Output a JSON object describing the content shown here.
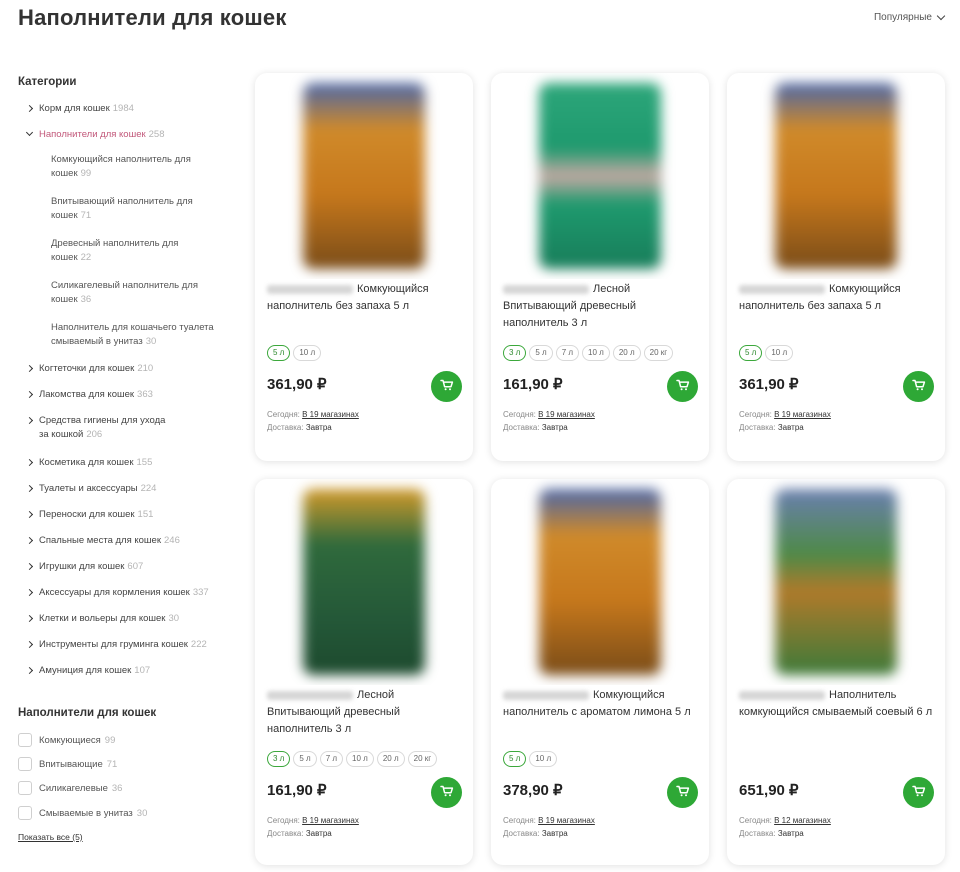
{
  "page": {
    "title": "Наполнители для кошек",
    "sort_label": "Популярные"
  },
  "sidebar": {
    "heading": "Категории",
    "categories": [
      {
        "label": "Корм для кошек",
        "count": "1984"
      },
      {
        "label": "Наполнители для кошек",
        "count": "258"
      },
      {
        "label": "Когтеточки для кошек",
        "count": "210"
      },
      {
        "label": "Лакомства для кошек",
        "count": "363"
      },
      {
        "label": "Средства гигиены для ухода",
        "label2": "за кошкой",
        "count": "206"
      },
      {
        "label": "Косметика для кошек",
        "count": "155"
      },
      {
        "label": "Туалеты и аксессуары",
        "count": "224"
      },
      {
        "label": "Переноски для кошек",
        "count": "151"
      },
      {
        "label": "Спальные места для кошек",
        "count": "246"
      },
      {
        "label": "Игрушки для кошек",
        "count": "607"
      },
      {
        "label": "Аксессуары для кормления кошек",
        "count": "337"
      },
      {
        "label": "Клетки и вольеры для кошек",
        "count": "30"
      },
      {
        "label": "Инструменты для груминга кошек",
        "count": "222"
      },
      {
        "label": "Амуниция для кошек",
        "count": "107"
      }
    ],
    "subcategories": [
      {
        "line1": "Комкующийся наполнитель для",
        "line2": "кошек",
        "count": "99"
      },
      {
        "line1": "Впитывающий наполнитель для",
        "line2": "кошек",
        "count": "71"
      },
      {
        "line1": "Древесный наполнитель для",
        "line2": "кошек",
        "count": "22"
      },
      {
        "line1": "Силикагелевый наполнитель для",
        "line2": "кошек",
        "count": "36"
      },
      {
        "line1": "Наполнитель для кошачьего туалета",
        "line2": "смываемый в унитаз",
        "count": "30"
      }
    ]
  },
  "filters": {
    "heading": "Наполнители для кошек",
    "items": [
      {
        "label": "Комкующиеся",
        "count": "99"
      },
      {
        "label": "Впитывающие",
        "count": "71"
      },
      {
        "label": "Силикагелевые",
        "count": "36"
      },
      {
        "label": "Смываемые в унитаз",
        "count": "30"
      }
    ],
    "show_all": "Показать все (5)"
  },
  "product_meta": {
    "today_label": "Сегодня:",
    "delivery_label": "Доставка:"
  },
  "products": [
    {
      "title": "Комкующийся наполнитель без запаха 5 л",
      "sizes": [
        "5 л",
        "10 л"
      ],
      "price": "361,90 ₽",
      "stores": "В 19 магазинах",
      "delivery": "Завтра",
      "image_color": "orange"
    },
    {
      "title": "Лесной Впитывающий древесный наполнитель 3 л",
      "sizes": [
        "3 л",
        "5 л",
        "7 л",
        "10 л",
        "20 л",
        "20 кг"
      ],
      "price": "161,90 ₽",
      "stores": "В 19 магазинах",
      "delivery": "Завтра",
      "image_color": "green"
    },
    {
      "title": "Комкующийся наполнитель без запаха 5 л",
      "sizes": [
        "5 л",
        "10 л"
      ],
      "price": "361,90 ₽",
      "stores": "В 19 магазинах",
      "delivery": "Завтра",
      "image_color": "orange"
    },
    {
      "title": "Лесной Впитывающий древесный наполнитель 3 л",
      "sizes": [
        "3 л",
        "5 л",
        "7 л",
        "10 л",
        "20 л",
        "20 кг"
      ],
      "price": "161,90 ₽",
      "stores": "В 19 магазинах",
      "delivery": "Завтра",
      "image_color": "darkgreen"
    },
    {
      "title": "Комкующийся наполнитель с ароматом лимона 5 л",
      "sizes": [
        "5 л",
        "10 л"
      ],
      "price": "378,90 ₽",
      "stores": "В 19 магазинах",
      "delivery": "Завтра",
      "image_color": "orange"
    },
    {
      "title": "Наполнитель комкующийся смываемый соевый 6 л",
      "sizes": [],
      "price": "651,90 ₽",
      "stores": "В 12 магазинах",
      "delivery": "Завтра",
      "image_color": "olive"
    }
  ],
  "colors": {
    "accent_green": "#2ea836",
    "active_category": "#c2587a",
    "count_gray": "#b4b4b4"
  }
}
